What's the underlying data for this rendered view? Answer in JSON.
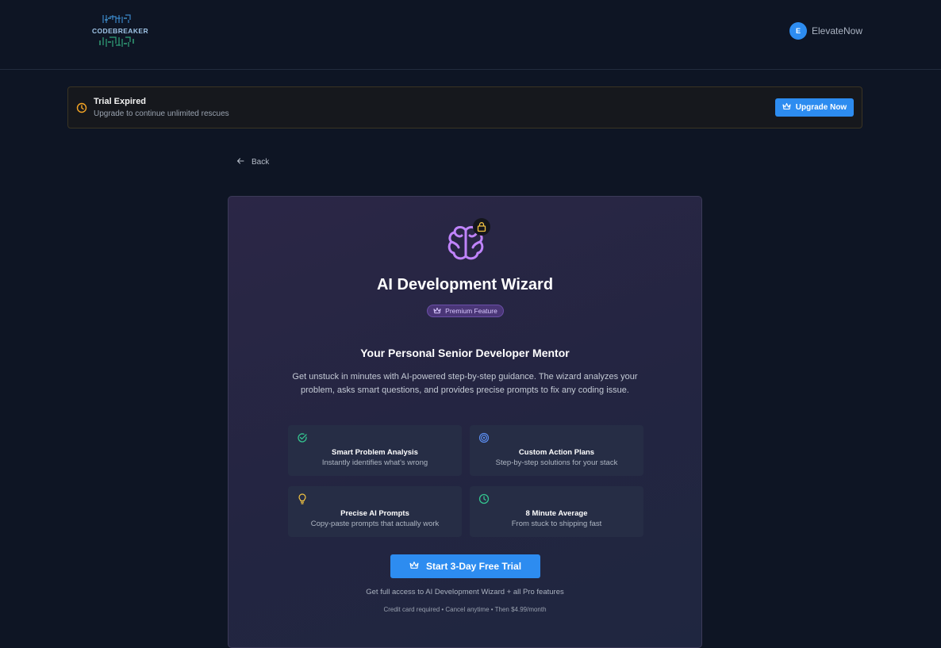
{
  "header": {
    "logo_text": "CODEBREAKER",
    "user": {
      "initial": "E",
      "name": "ElevateNow"
    }
  },
  "banner": {
    "title": "Trial Expired",
    "subtitle": "Upgrade to continue unlimited rescues",
    "button_label": "Upgrade Now",
    "accent": "#f5a524"
  },
  "nav": {
    "back_label": "Back"
  },
  "card": {
    "title": "AI Development Wizard",
    "badge": "Premium Feature",
    "subtitle": "Your Personal Senior Developer Mentor",
    "description": "Get unstuck in minutes with AI-powered step-by-step guidance. The wizard analyzes your problem, asks smart questions, and provides precise prompts to fix any coding issue.",
    "features": [
      {
        "icon": "check-circle-icon",
        "title": "Smart Problem Analysis",
        "description": "Instantly identifies what's wrong",
        "color": "#34c38f"
      },
      {
        "icon": "target-icon",
        "title": "Custom Action Plans",
        "description": "Step-by-step solutions for your stack",
        "color": "#5b8def"
      },
      {
        "icon": "lightbulb-icon",
        "title": "Precise AI Prompts",
        "description": "Copy-paste prompts that actually work",
        "color": "#f5c542"
      },
      {
        "icon": "clock-icon",
        "title": "8 Minute Average",
        "description": "From stuck to shipping fast",
        "color": "#34c38f"
      }
    ],
    "cta_label": "Start 3-Day Free Trial",
    "cta_note": "Get full access to AI Development Wizard + all Pro features",
    "fine_print": "Credit card required • Cancel anytime • Then $4.99/month"
  },
  "colors": {
    "background": "#0e1524",
    "primary": "#2d8cf0",
    "brain": "#c084fc",
    "lock": "#f5c542"
  }
}
